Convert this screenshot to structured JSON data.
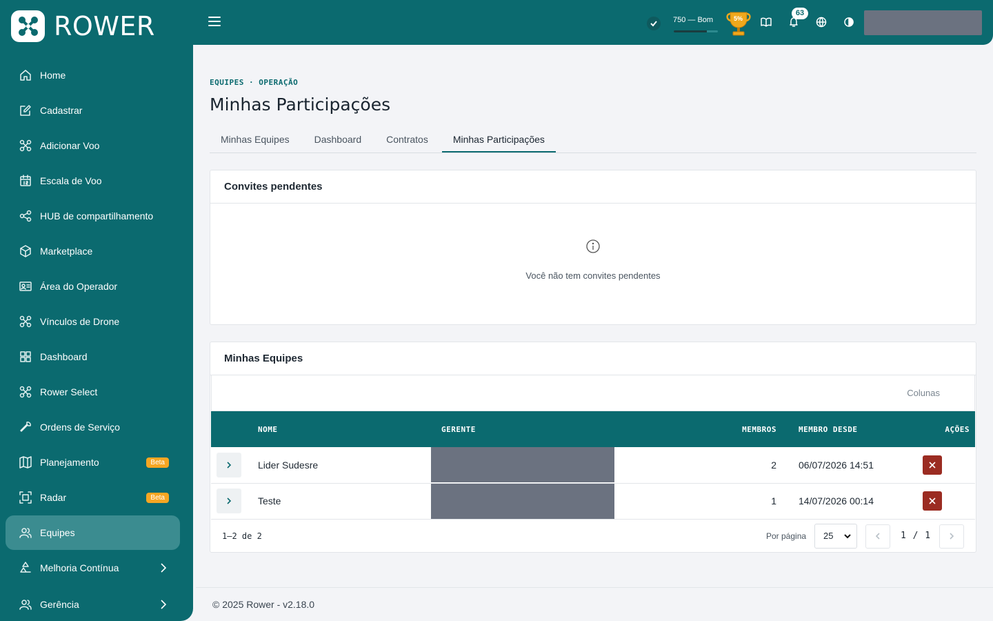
{
  "brand": {
    "name": "ROWER"
  },
  "sidebar": {
    "items": [
      {
        "label": "Home",
        "icon": "home-icon"
      },
      {
        "label": "Cadastrar",
        "icon": "edit-icon"
      },
      {
        "label": "Adicionar Voo",
        "icon": "drone-icon"
      },
      {
        "label": "Escala de Voo",
        "icon": "calendar-icon"
      },
      {
        "label": "HUB de compartilhamento",
        "icon": "share-icon"
      },
      {
        "label": "Marketplace",
        "icon": "box-icon"
      },
      {
        "label": "Área do Operador",
        "icon": "id-card-icon"
      },
      {
        "label": "Vínculos de Drone",
        "icon": "drone-icon"
      },
      {
        "label": "Dashboard",
        "icon": "grid-icon"
      },
      {
        "label": "Rower Select",
        "icon": "drone-icon"
      },
      {
        "label": "Ordens de Serviço",
        "icon": "wrench-icon"
      },
      {
        "label": "Planejamento",
        "icon": "map-icon",
        "badge": "Beta"
      },
      {
        "label": "Radar",
        "icon": "radar-icon",
        "badge": "Beta"
      },
      {
        "label": "Equipes",
        "icon": "users-icon",
        "active": true
      },
      {
        "label": "Melhoria Contínua",
        "icon": "recycle-icon"
      },
      {
        "label": "Gerência",
        "icon": "users-icon"
      }
    ]
  },
  "topbar": {
    "score_text": "750 — Bom",
    "score_fraction": 0.75,
    "trophy_text": "5%",
    "notifications_count": "63"
  },
  "page": {
    "breadcrumb": "EQUIPES · OPERAÇÃO",
    "title": "Minhas Participações",
    "tabs": [
      {
        "label": "Minhas Equipes"
      },
      {
        "label": "Dashboard"
      },
      {
        "label": "Contratos"
      },
      {
        "label": "Minhas Participações",
        "active": true
      }
    ]
  },
  "invites": {
    "title": "Convites pendentes",
    "empty_text": "Você não tem convites pendentes"
  },
  "teams": {
    "title": "Minhas Equipes",
    "columns_button": "Colunas",
    "headers": {
      "nome": "NOME",
      "gerente": "GERENTE",
      "membros": "MEMBROS",
      "membro_desde": "MEMBRO DESDE",
      "acoes": "AÇÕES"
    },
    "rows": [
      {
        "nome": "Lider Sudesre",
        "membros": "2",
        "membro_desde": "06/07/2026 14:51"
      },
      {
        "nome": "Teste",
        "membros": "1",
        "membro_desde": "14/07/2026 00:14"
      }
    ],
    "range": "1–2 de 2",
    "per_page_label": "Por página",
    "per_page_value": "25",
    "page_info": "1 / 1"
  },
  "footer": {
    "text": "© 2025 Rower - v2.18.0"
  },
  "colors": {
    "primary": "#0b6a6f",
    "active_nav": "#3b8c90",
    "beta": "#f6a623",
    "danger": "#9b2c22"
  }
}
